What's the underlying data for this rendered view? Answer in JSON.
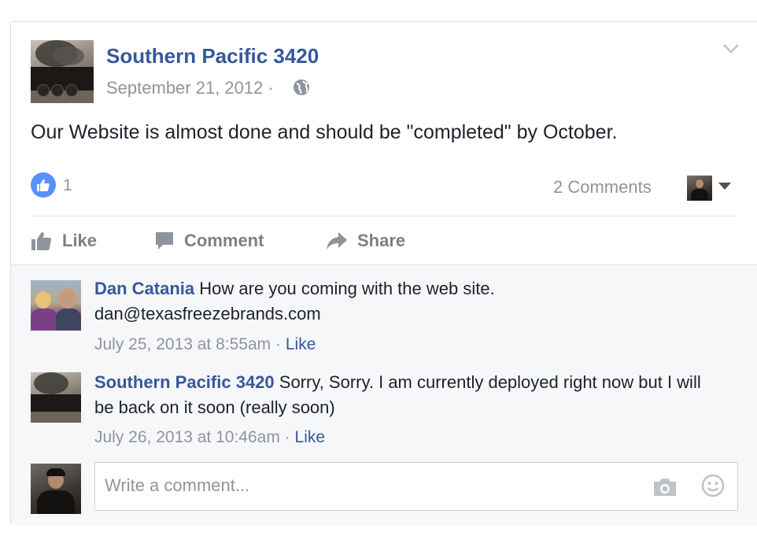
{
  "post": {
    "author": "Southern Pacific 3420",
    "date": "September 21, 2012",
    "date_separator": "·",
    "privacy_icon": "globe-icon",
    "text": "Our Website is almost done and should be \"completed\" by October.",
    "like_count": "1",
    "comments_count": "2 Comments"
  },
  "actions": {
    "like": "Like",
    "comment": "Comment",
    "share": "Share"
  },
  "comments": [
    {
      "author": "Dan Catania",
      "text": "How are you coming with the web site. dan@texasfreezebrands.com",
      "timestamp": "July 25, 2013 at 8:55am",
      "separator": "·",
      "like_label": "Like"
    },
    {
      "author": "Southern Pacific 3420",
      "text": "Sorry, Sorry. I am currently deployed right now but I will be back on it soon (really soon)",
      "timestamp": "July 26, 2013 at 10:46am",
      "separator": "·",
      "like_label": "Like"
    }
  ],
  "composer": {
    "placeholder": "Write a comment..."
  },
  "colors": {
    "link_blue": "#365899",
    "like_blue": "#5890ff",
    "meta_gray": "#90949c",
    "comments_bg": "#f6f7f9"
  }
}
